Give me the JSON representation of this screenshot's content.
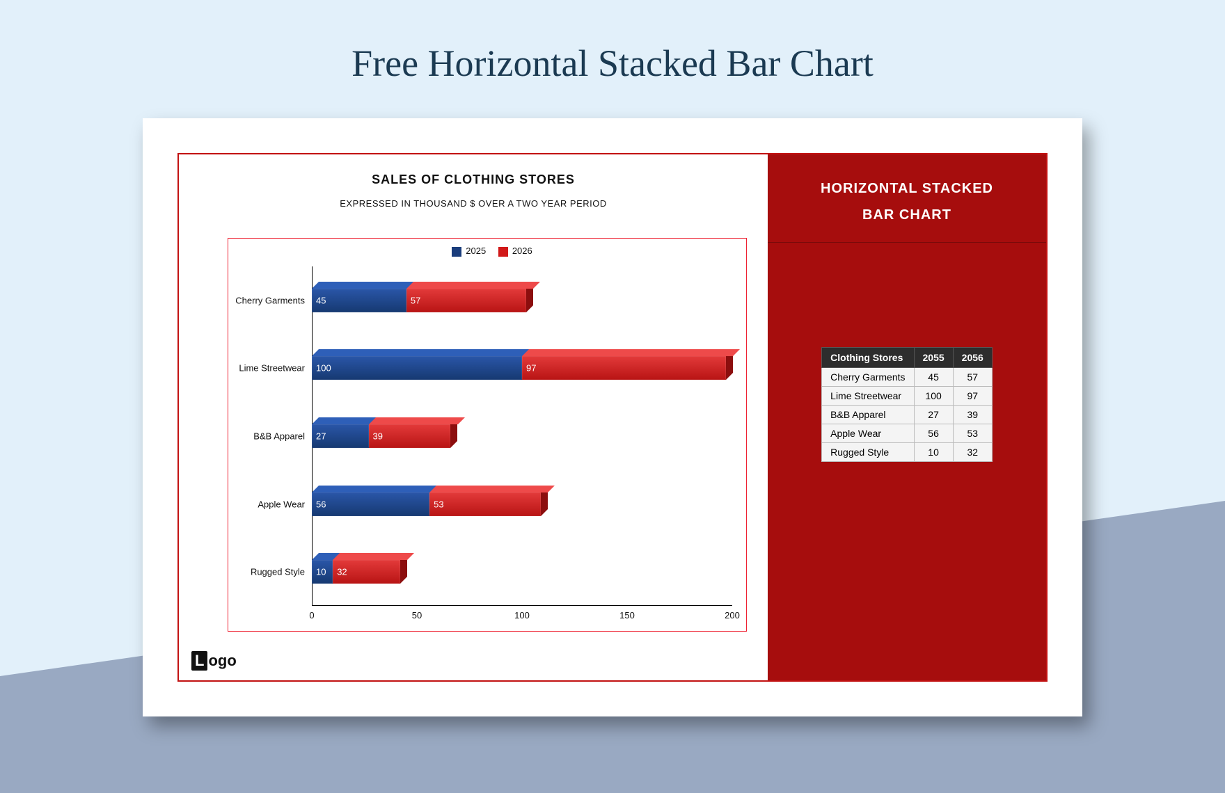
{
  "heading": "Free Horizontal Stacked Bar Chart",
  "logo_initial": "L",
  "logo_rest": "ogo",
  "chart": {
    "title": "SALES OF CLOTHING STORES",
    "subtitle": "EXPRESSED IN THOUSAND $ OVER A TWO YEAR PERIOD",
    "legend_a": "2025",
    "legend_b": "2026"
  },
  "panel": {
    "title_line1": "HORIZONTAL STACKED",
    "title_line2": "BAR CHART"
  },
  "table": {
    "h0": "Clothing Stores",
    "h1": "2055",
    "h2": "2056",
    "rows": [
      {
        "name": "Cherry Garments",
        "a": "45",
        "b": "57"
      },
      {
        "name": "Lime Streetwear",
        "a": "100",
        "b": "97"
      },
      {
        "name": "B&B Apparel",
        "a": "27",
        "b": "39"
      },
      {
        "name": "Apple Wear",
        "a": "56",
        "b": "53"
      },
      {
        "name": "Rugged Style",
        "a": "10",
        "b": "32"
      }
    ]
  },
  "chart_data": {
    "type": "bar",
    "orientation": "horizontal",
    "stacked": true,
    "title": "SALES OF CLOTHING STORES",
    "subtitle": "EXPRESSED IN THOUSAND $ OVER A TWO YEAR PERIOD",
    "categories": [
      "Cherry Garments",
      "Lime Streetwear",
      "B&B Apparel",
      "Apple Wear",
      "Rugged Style"
    ],
    "series": [
      {
        "name": "2025",
        "color": "#1a3d7c",
        "values": [
          45,
          100,
          27,
          56,
          10
        ]
      },
      {
        "name": "2026",
        "color": "#d11919",
        "values": [
          57,
          97,
          39,
          53,
          32
        ]
      }
    ],
    "xlabel": "",
    "ylabel": "",
    "xlim": [
      0,
      200
    ],
    "xticks": [
      0,
      50,
      100,
      150,
      200
    ],
    "legend_position": "top"
  }
}
